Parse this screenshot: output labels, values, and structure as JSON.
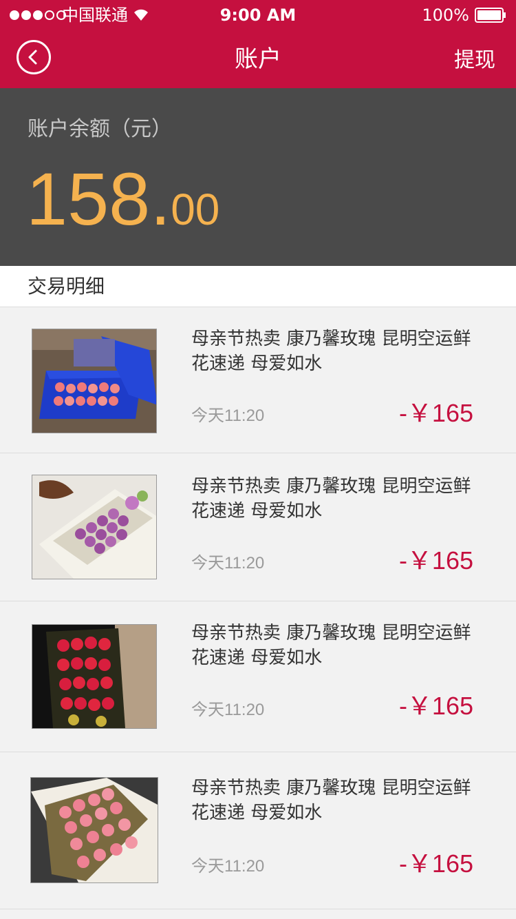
{
  "status_bar": {
    "carrier": "中国联通",
    "time": "9:00 AM",
    "battery": "100%"
  },
  "nav": {
    "title": "账户",
    "action": "提现",
    "back_icon": "chevron-left-icon"
  },
  "balance": {
    "label": "账户余额（元）",
    "amount_integer": "158.",
    "amount_decimal": "00"
  },
  "section": {
    "title": "交易明细"
  },
  "transactions": [
    {
      "title": "母亲节热卖 康乃馨玫瑰 昆明空运鲜花速递 母爱如水",
      "date": "今天11:20",
      "amount": "-￥165",
      "image": "blue-box-pink-roses"
    },
    {
      "title": "母亲节热卖 康乃馨玫瑰 昆明空运鲜花速递 母爱如水",
      "date": "今天11:20",
      "amount": "-￥165",
      "image": "white-box-purple-roses"
    },
    {
      "title": "母亲节热卖 康乃馨玫瑰 昆明空运鲜花速递 母爱如水",
      "date": "今天11:20",
      "amount": "-￥165",
      "image": "kraft-box-red-roses"
    },
    {
      "title": "母亲节热卖 康乃馨玫瑰 昆明空运鲜花速递 母爱如水",
      "date": "今天11:20",
      "amount": "-￥165",
      "image": "white-box-pink-roses"
    }
  ],
  "colors": {
    "brand": "#c5103f",
    "balance_bg": "#4a4a4a",
    "balance_amount": "#f5b24f",
    "price": "#c5103f"
  }
}
